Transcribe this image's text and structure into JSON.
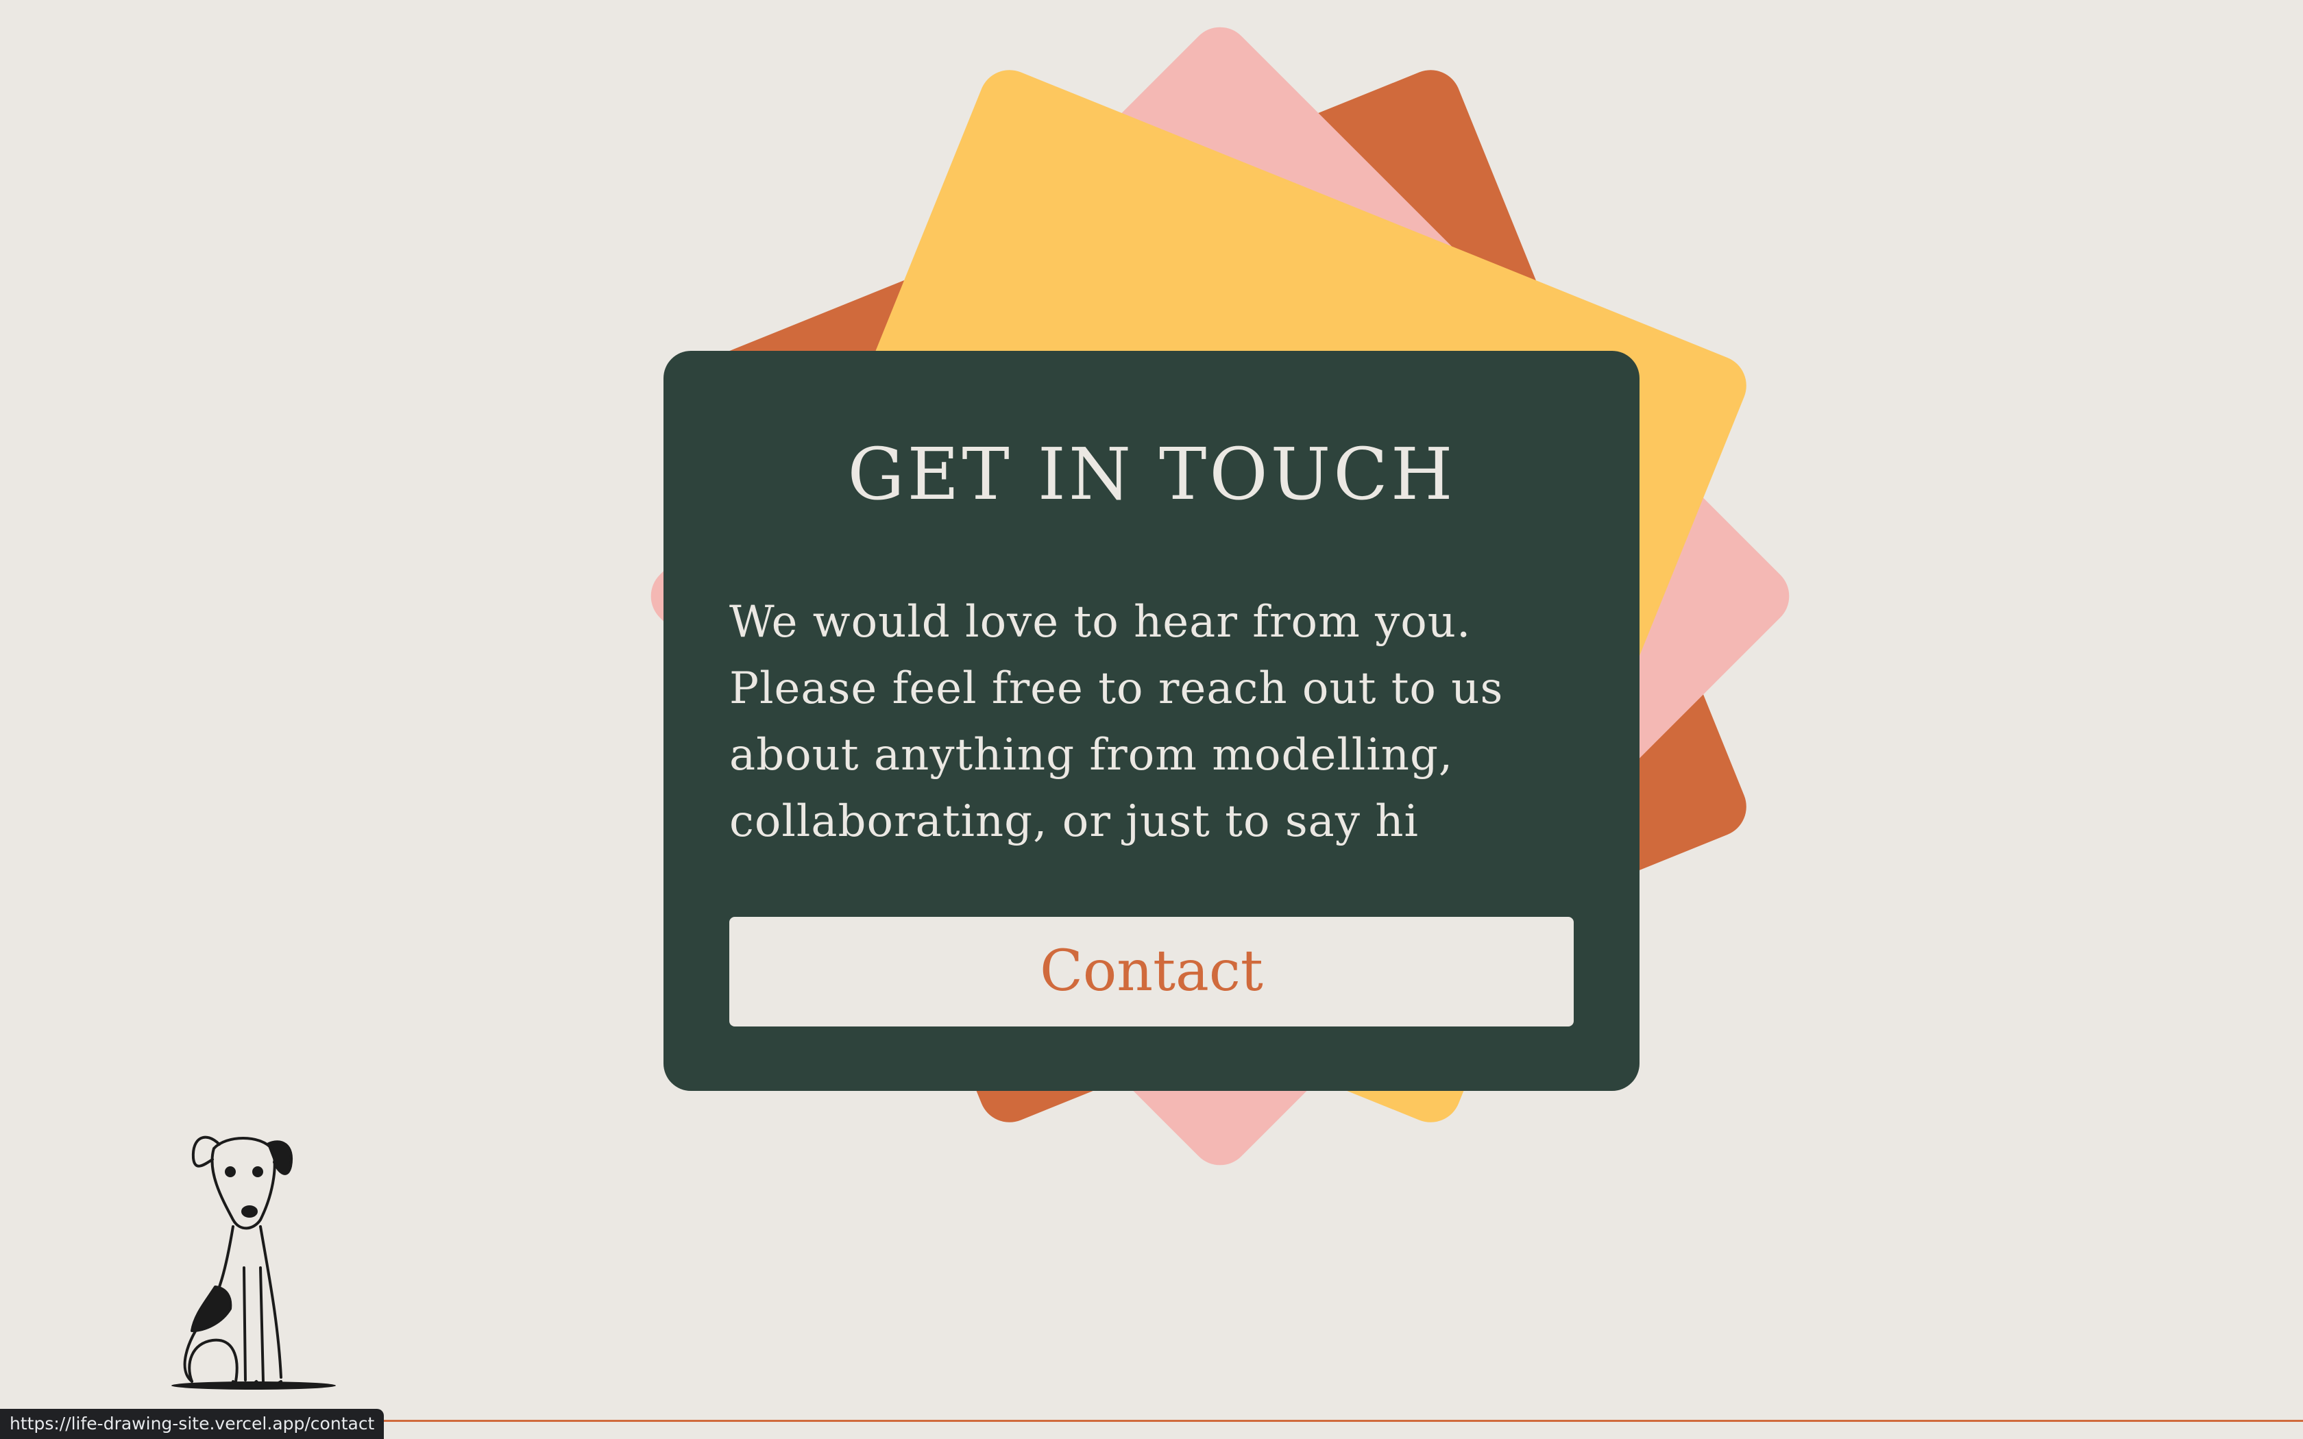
{
  "contact": {
    "title": "GET IN TOUCH",
    "body": "We would love to hear from you. Please feel free to reach out to us about anything from modelling, collaborating, or just to say hi",
    "button_label": "Contact"
  },
  "status_bar": {
    "url": "https://life-drawing-site.vercel.app/contact"
  },
  "colors": {
    "background": "#ebe8e3",
    "card_dark_green": "#2e433c",
    "orange": "#d06a3c",
    "pink": "#f4b8b4",
    "yellow": "#fdc75e"
  },
  "icons": {
    "dog": "dog-illustration-icon"
  }
}
